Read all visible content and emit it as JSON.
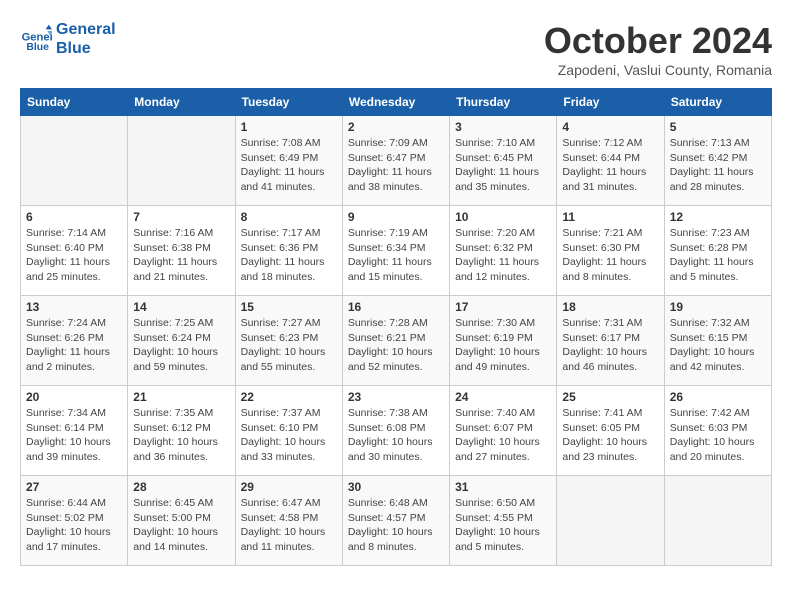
{
  "logo": {
    "line1": "General",
    "line2": "Blue"
  },
  "title": "October 2024",
  "subtitle": "Zapodeni, Vaslui County, Romania",
  "days_of_week": [
    "Sunday",
    "Monday",
    "Tuesday",
    "Wednesday",
    "Thursday",
    "Friday",
    "Saturday"
  ],
  "weeks": [
    [
      {
        "day": "",
        "info": ""
      },
      {
        "day": "",
        "info": ""
      },
      {
        "day": "1",
        "info": "Sunrise: 7:08 AM\nSunset: 6:49 PM\nDaylight: 11 hours and 41 minutes."
      },
      {
        "day": "2",
        "info": "Sunrise: 7:09 AM\nSunset: 6:47 PM\nDaylight: 11 hours and 38 minutes."
      },
      {
        "day": "3",
        "info": "Sunrise: 7:10 AM\nSunset: 6:45 PM\nDaylight: 11 hours and 35 minutes."
      },
      {
        "day": "4",
        "info": "Sunrise: 7:12 AM\nSunset: 6:44 PM\nDaylight: 11 hours and 31 minutes."
      },
      {
        "day": "5",
        "info": "Sunrise: 7:13 AM\nSunset: 6:42 PM\nDaylight: 11 hours and 28 minutes."
      }
    ],
    [
      {
        "day": "6",
        "info": "Sunrise: 7:14 AM\nSunset: 6:40 PM\nDaylight: 11 hours and 25 minutes."
      },
      {
        "day": "7",
        "info": "Sunrise: 7:16 AM\nSunset: 6:38 PM\nDaylight: 11 hours and 21 minutes."
      },
      {
        "day": "8",
        "info": "Sunrise: 7:17 AM\nSunset: 6:36 PM\nDaylight: 11 hours and 18 minutes."
      },
      {
        "day": "9",
        "info": "Sunrise: 7:19 AM\nSunset: 6:34 PM\nDaylight: 11 hours and 15 minutes."
      },
      {
        "day": "10",
        "info": "Sunrise: 7:20 AM\nSunset: 6:32 PM\nDaylight: 11 hours and 12 minutes."
      },
      {
        "day": "11",
        "info": "Sunrise: 7:21 AM\nSunset: 6:30 PM\nDaylight: 11 hours and 8 minutes."
      },
      {
        "day": "12",
        "info": "Sunrise: 7:23 AM\nSunset: 6:28 PM\nDaylight: 11 hours and 5 minutes."
      }
    ],
    [
      {
        "day": "13",
        "info": "Sunrise: 7:24 AM\nSunset: 6:26 PM\nDaylight: 11 hours and 2 minutes."
      },
      {
        "day": "14",
        "info": "Sunrise: 7:25 AM\nSunset: 6:24 PM\nDaylight: 10 hours and 59 minutes."
      },
      {
        "day": "15",
        "info": "Sunrise: 7:27 AM\nSunset: 6:23 PM\nDaylight: 10 hours and 55 minutes."
      },
      {
        "day": "16",
        "info": "Sunrise: 7:28 AM\nSunset: 6:21 PM\nDaylight: 10 hours and 52 minutes."
      },
      {
        "day": "17",
        "info": "Sunrise: 7:30 AM\nSunset: 6:19 PM\nDaylight: 10 hours and 49 minutes."
      },
      {
        "day": "18",
        "info": "Sunrise: 7:31 AM\nSunset: 6:17 PM\nDaylight: 10 hours and 46 minutes."
      },
      {
        "day": "19",
        "info": "Sunrise: 7:32 AM\nSunset: 6:15 PM\nDaylight: 10 hours and 42 minutes."
      }
    ],
    [
      {
        "day": "20",
        "info": "Sunrise: 7:34 AM\nSunset: 6:14 PM\nDaylight: 10 hours and 39 minutes."
      },
      {
        "day": "21",
        "info": "Sunrise: 7:35 AM\nSunset: 6:12 PM\nDaylight: 10 hours and 36 minutes."
      },
      {
        "day": "22",
        "info": "Sunrise: 7:37 AM\nSunset: 6:10 PM\nDaylight: 10 hours and 33 minutes."
      },
      {
        "day": "23",
        "info": "Sunrise: 7:38 AM\nSunset: 6:08 PM\nDaylight: 10 hours and 30 minutes."
      },
      {
        "day": "24",
        "info": "Sunrise: 7:40 AM\nSunset: 6:07 PM\nDaylight: 10 hours and 27 minutes."
      },
      {
        "day": "25",
        "info": "Sunrise: 7:41 AM\nSunset: 6:05 PM\nDaylight: 10 hours and 23 minutes."
      },
      {
        "day": "26",
        "info": "Sunrise: 7:42 AM\nSunset: 6:03 PM\nDaylight: 10 hours and 20 minutes."
      }
    ],
    [
      {
        "day": "27",
        "info": "Sunrise: 6:44 AM\nSunset: 5:02 PM\nDaylight: 10 hours and 17 minutes."
      },
      {
        "day": "28",
        "info": "Sunrise: 6:45 AM\nSunset: 5:00 PM\nDaylight: 10 hours and 14 minutes."
      },
      {
        "day": "29",
        "info": "Sunrise: 6:47 AM\nSunset: 4:58 PM\nDaylight: 10 hours and 11 minutes."
      },
      {
        "day": "30",
        "info": "Sunrise: 6:48 AM\nSunset: 4:57 PM\nDaylight: 10 hours and 8 minutes."
      },
      {
        "day": "31",
        "info": "Sunrise: 6:50 AM\nSunset: 4:55 PM\nDaylight: 10 hours and 5 minutes."
      },
      {
        "day": "",
        "info": ""
      },
      {
        "day": "",
        "info": ""
      }
    ]
  ]
}
